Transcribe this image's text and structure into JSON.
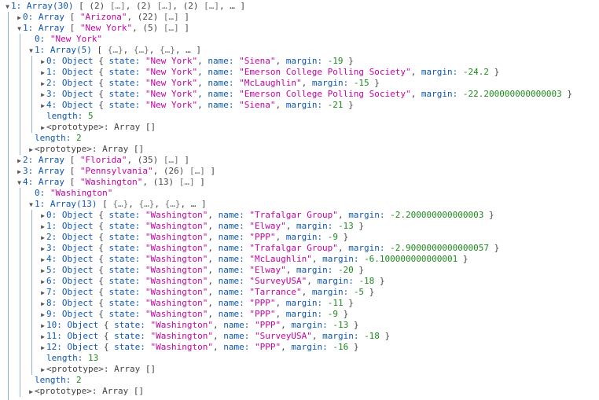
{
  "rows": [
    {
      "d": 0,
      "exp": "open",
      "parts": [
        [
          "k",
          "1: "
        ],
        [
          "t",
          "Array(30)"
        ],
        [
          "p",
          " [ (2) "
        ],
        [
          "m",
          "[…]"
        ],
        [
          "p",
          ", (2) "
        ],
        [
          "m",
          "[…]"
        ],
        [
          "p",
          ", (2) "
        ],
        [
          "m",
          "[…]"
        ],
        [
          "p",
          ", … ]"
        ]
      ]
    },
    {
      "d": 1,
      "exp": "closed",
      "parts": [
        [
          "k",
          "0: "
        ],
        [
          "t",
          "Array"
        ],
        [
          "p",
          " [ "
        ],
        [
          "s",
          "\"Arizona\""
        ],
        [
          "p",
          ", (22) "
        ],
        [
          "m",
          "[…]"
        ],
        [
          "p",
          " ]"
        ]
      ]
    },
    {
      "d": 1,
      "exp": "open",
      "parts": [
        [
          "k",
          "1: "
        ],
        [
          "t",
          "Array"
        ],
        [
          "p",
          " [ "
        ],
        [
          "s",
          "\"New York\""
        ],
        [
          "p",
          ", (5) "
        ],
        [
          "m",
          "[…]"
        ],
        [
          "p",
          " ]"
        ]
      ]
    },
    {
      "d": 2,
      "exp": "none",
      "parts": [
        [
          "k",
          "0: "
        ],
        [
          "s",
          "\"New York\""
        ]
      ]
    },
    {
      "d": 2,
      "exp": "open",
      "parts": [
        [
          "k",
          "1: "
        ],
        [
          "t",
          "Array(5)"
        ],
        [
          "p",
          " [ "
        ],
        [
          "m",
          "{…}"
        ],
        [
          "p",
          ", "
        ],
        [
          "m",
          "{…}"
        ],
        [
          "p",
          ", "
        ],
        [
          "m",
          "{…}"
        ],
        [
          "p",
          ", … ]"
        ]
      ]
    },
    {
      "d": 3,
      "exp": "closed",
      "parts": [
        [
          "k",
          "0: "
        ],
        [
          "t",
          "Object"
        ],
        [
          "p",
          " { "
        ],
        [
          "k",
          "state: "
        ],
        [
          "s",
          "\"New York\""
        ],
        [
          "p",
          ", "
        ],
        [
          "k",
          "name: "
        ],
        [
          "s",
          "\"Siena\""
        ],
        [
          "p",
          ", "
        ],
        [
          "k",
          "margin: "
        ],
        [
          "n",
          "-19"
        ],
        [
          "p",
          " }"
        ]
      ]
    },
    {
      "d": 3,
      "exp": "closed",
      "parts": [
        [
          "k",
          "1: "
        ],
        [
          "t",
          "Object"
        ],
        [
          "p",
          " { "
        ],
        [
          "k",
          "state: "
        ],
        [
          "s",
          "\"New York\""
        ],
        [
          "p",
          ", "
        ],
        [
          "k",
          "name: "
        ],
        [
          "s",
          "\"Emerson College Polling Society\""
        ],
        [
          "p",
          ", "
        ],
        [
          "k",
          "margin: "
        ],
        [
          "n",
          "-24.2"
        ],
        [
          "p",
          " }"
        ]
      ]
    },
    {
      "d": 3,
      "exp": "closed",
      "parts": [
        [
          "k",
          "2: "
        ],
        [
          "t",
          "Object"
        ],
        [
          "p",
          " { "
        ],
        [
          "k",
          "state: "
        ],
        [
          "s",
          "\"New York\""
        ],
        [
          "p",
          ", "
        ],
        [
          "k",
          "name: "
        ],
        [
          "s",
          "\"McLaughlin\""
        ],
        [
          "p",
          ", "
        ],
        [
          "k",
          "margin: "
        ],
        [
          "n",
          "-15"
        ],
        [
          "p",
          " }"
        ]
      ]
    },
    {
      "d": 3,
      "exp": "closed",
      "parts": [
        [
          "k",
          "3: "
        ],
        [
          "t",
          "Object"
        ],
        [
          "p",
          " { "
        ],
        [
          "k",
          "state: "
        ],
        [
          "s",
          "\"New York\""
        ],
        [
          "p",
          ", "
        ],
        [
          "k",
          "name: "
        ],
        [
          "s",
          "\"Emerson College Polling Society\""
        ],
        [
          "p",
          ", "
        ],
        [
          "k",
          "margin: "
        ],
        [
          "n",
          "-22.200000000000003"
        ],
        [
          "p",
          " }"
        ]
      ]
    },
    {
      "d": 3,
      "exp": "closed",
      "parts": [
        [
          "k",
          "4: "
        ],
        [
          "t",
          "Object"
        ],
        [
          "p",
          " { "
        ],
        [
          "k",
          "state: "
        ],
        [
          "s",
          "\"New York\""
        ],
        [
          "p",
          ", "
        ],
        [
          "k",
          "name: "
        ],
        [
          "s",
          "\"Siena\""
        ],
        [
          "p",
          ", "
        ],
        [
          "k",
          "margin: "
        ],
        [
          "n",
          "-21"
        ],
        [
          "p",
          " }"
        ]
      ]
    },
    {
      "d": 3,
      "exp": "none",
      "parts": [
        [
          "k",
          "length: "
        ],
        [
          "n",
          "5"
        ]
      ]
    },
    {
      "d": 3,
      "exp": "closed",
      "parts": [
        [
          "p",
          "<prototype>: Array []"
        ]
      ]
    },
    {
      "d": 2,
      "exp": "none",
      "parts": [
        [
          "k",
          "length: "
        ],
        [
          "n",
          "2"
        ]
      ]
    },
    {
      "d": 2,
      "exp": "closed",
      "parts": [
        [
          "p",
          "<prototype>: Array []"
        ]
      ]
    },
    {
      "d": 1,
      "exp": "closed",
      "parts": [
        [
          "k",
          "2: "
        ],
        [
          "t",
          "Array"
        ],
        [
          "p",
          " [ "
        ],
        [
          "s",
          "\"Florida\""
        ],
        [
          "p",
          ", (35) "
        ],
        [
          "m",
          "[…]"
        ],
        [
          "p",
          " ]"
        ]
      ]
    },
    {
      "d": 1,
      "exp": "closed",
      "parts": [
        [
          "k",
          "3: "
        ],
        [
          "t",
          "Array"
        ],
        [
          "p",
          " [ "
        ],
        [
          "s",
          "\"Pennsylvania\""
        ],
        [
          "p",
          ", (26) "
        ],
        [
          "m",
          "[…]"
        ],
        [
          "p",
          " ]"
        ]
      ]
    },
    {
      "d": 1,
      "exp": "open",
      "parts": [
        [
          "k",
          "4: "
        ],
        [
          "t",
          "Array"
        ],
        [
          "p",
          " [ "
        ],
        [
          "s",
          "\"Washington\""
        ],
        [
          "p",
          ", (13) "
        ],
        [
          "m",
          "[…]"
        ],
        [
          "p",
          " ]"
        ]
      ]
    },
    {
      "d": 2,
      "exp": "none",
      "parts": [
        [
          "k",
          "0: "
        ],
        [
          "s",
          "\"Washington\""
        ]
      ]
    },
    {
      "d": 2,
      "exp": "open",
      "parts": [
        [
          "k",
          "1: "
        ],
        [
          "t",
          "Array(13)"
        ],
        [
          "p",
          " [ "
        ],
        [
          "m",
          "{…}"
        ],
        [
          "p",
          ", "
        ],
        [
          "m",
          "{…}"
        ],
        [
          "p",
          ", "
        ],
        [
          "m",
          "{…}"
        ],
        [
          "p",
          ", … ]"
        ]
      ]
    },
    {
      "d": 3,
      "exp": "closed",
      "parts": [
        [
          "k",
          "0: "
        ],
        [
          "t",
          "Object"
        ],
        [
          "p",
          " { "
        ],
        [
          "k",
          "state: "
        ],
        [
          "s",
          "\"Washington\""
        ],
        [
          "p",
          ", "
        ],
        [
          "k",
          "name: "
        ],
        [
          "s",
          "\"Trafalgar Group\""
        ],
        [
          "p",
          ", "
        ],
        [
          "k",
          "margin: "
        ],
        [
          "n",
          "-2.200000000000003"
        ],
        [
          "p",
          " }"
        ]
      ]
    },
    {
      "d": 3,
      "exp": "closed",
      "parts": [
        [
          "k",
          "1: "
        ],
        [
          "t",
          "Object"
        ],
        [
          "p",
          " { "
        ],
        [
          "k",
          "state: "
        ],
        [
          "s",
          "\"Washington\""
        ],
        [
          "p",
          ", "
        ],
        [
          "k",
          "name: "
        ],
        [
          "s",
          "\"Elway\""
        ],
        [
          "p",
          ", "
        ],
        [
          "k",
          "margin: "
        ],
        [
          "n",
          "-13"
        ],
        [
          "p",
          " }"
        ]
      ]
    },
    {
      "d": 3,
      "exp": "closed",
      "parts": [
        [
          "k",
          "2: "
        ],
        [
          "t",
          "Object"
        ],
        [
          "p",
          " { "
        ],
        [
          "k",
          "state: "
        ],
        [
          "s",
          "\"Washington\""
        ],
        [
          "p",
          ", "
        ],
        [
          "k",
          "name: "
        ],
        [
          "s",
          "\"PPP\""
        ],
        [
          "p",
          ", "
        ],
        [
          "k",
          "margin: "
        ],
        [
          "n",
          "-9"
        ],
        [
          "p",
          " }"
        ]
      ]
    },
    {
      "d": 3,
      "exp": "closed",
      "parts": [
        [
          "k",
          "3: "
        ],
        [
          "t",
          "Object"
        ],
        [
          "p",
          " { "
        ],
        [
          "k",
          "state: "
        ],
        [
          "s",
          "\"Washington\""
        ],
        [
          "p",
          ", "
        ],
        [
          "k",
          "name: "
        ],
        [
          "s",
          "\"Trafalgar Group\""
        ],
        [
          "p",
          ", "
        ],
        [
          "k",
          "margin: "
        ],
        [
          "n",
          "-2.9000000000000057"
        ],
        [
          "p",
          " }"
        ]
      ]
    },
    {
      "d": 3,
      "exp": "closed",
      "parts": [
        [
          "k",
          "4: "
        ],
        [
          "t",
          "Object"
        ],
        [
          "p",
          " { "
        ],
        [
          "k",
          "state: "
        ],
        [
          "s",
          "\"Washington\""
        ],
        [
          "p",
          ", "
        ],
        [
          "k",
          "name: "
        ],
        [
          "s",
          "\"McLaughlin\""
        ],
        [
          "p",
          ", "
        ],
        [
          "k",
          "margin: "
        ],
        [
          "n",
          "-6.100000000000001"
        ],
        [
          "p",
          " }"
        ]
      ]
    },
    {
      "d": 3,
      "exp": "closed",
      "parts": [
        [
          "k",
          "5: "
        ],
        [
          "t",
          "Object"
        ],
        [
          "p",
          " { "
        ],
        [
          "k",
          "state: "
        ],
        [
          "s",
          "\"Washington\""
        ],
        [
          "p",
          ", "
        ],
        [
          "k",
          "name: "
        ],
        [
          "s",
          "\"Elway\""
        ],
        [
          "p",
          ", "
        ],
        [
          "k",
          "margin: "
        ],
        [
          "n",
          "-20"
        ],
        [
          "p",
          " }"
        ]
      ]
    },
    {
      "d": 3,
      "exp": "closed",
      "parts": [
        [
          "k",
          "6: "
        ],
        [
          "t",
          "Object"
        ],
        [
          "p",
          " { "
        ],
        [
          "k",
          "state: "
        ],
        [
          "s",
          "\"Washington\""
        ],
        [
          "p",
          ", "
        ],
        [
          "k",
          "name: "
        ],
        [
          "s",
          "\"SurveyUSA\""
        ],
        [
          "p",
          ", "
        ],
        [
          "k",
          "margin: "
        ],
        [
          "n",
          "-18"
        ],
        [
          "p",
          " }"
        ]
      ]
    },
    {
      "d": 3,
      "exp": "closed",
      "parts": [
        [
          "k",
          "7: "
        ],
        [
          "t",
          "Object"
        ],
        [
          "p",
          " { "
        ],
        [
          "k",
          "state: "
        ],
        [
          "s",
          "\"Washington\""
        ],
        [
          "p",
          ", "
        ],
        [
          "k",
          "name: "
        ],
        [
          "s",
          "\"Tarrance\""
        ],
        [
          "p",
          ", "
        ],
        [
          "k",
          "margin: "
        ],
        [
          "n",
          "-5"
        ],
        [
          "p",
          " }"
        ]
      ]
    },
    {
      "d": 3,
      "exp": "closed",
      "parts": [
        [
          "k",
          "8: "
        ],
        [
          "t",
          "Object"
        ],
        [
          "p",
          " { "
        ],
        [
          "k",
          "state: "
        ],
        [
          "s",
          "\"Washington\""
        ],
        [
          "p",
          ", "
        ],
        [
          "k",
          "name: "
        ],
        [
          "s",
          "\"PPP\""
        ],
        [
          "p",
          ", "
        ],
        [
          "k",
          "margin: "
        ],
        [
          "n",
          "-11"
        ],
        [
          "p",
          " }"
        ]
      ]
    },
    {
      "d": 3,
      "exp": "closed",
      "parts": [
        [
          "k",
          "9: "
        ],
        [
          "t",
          "Object"
        ],
        [
          "p",
          " { "
        ],
        [
          "k",
          "state: "
        ],
        [
          "s",
          "\"Washington\""
        ],
        [
          "p",
          ", "
        ],
        [
          "k",
          "name: "
        ],
        [
          "s",
          "\"PPP\""
        ],
        [
          "p",
          ", "
        ],
        [
          "k",
          "margin: "
        ],
        [
          "n",
          "-9"
        ],
        [
          "p",
          " }"
        ]
      ]
    },
    {
      "d": 3,
      "exp": "closed",
      "parts": [
        [
          "k",
          "10: "
        ],
        [
          "t",
          "Object"
        ],
        [
          "p",
          " { "
        ],
        [
          "k",
          "state: "
        ],
        [
          "s",
          "\"Washington\""
        ],
        [
          "p",
          ", "
        ],
        [
          "k",
          "name: "
        ],
        [
          "s",
          "\"PPP\""
        ],
        [
          "p",
          ", "
        ],
        [
          "k",
          "margin: "
        ],
        [
          "n",
          "-13"
        ],
        [
          "p",
          " }"
        ]
      ]
    },
    {
      "d": 3,
      "exp": "closed",
      "parts": [
        [
          "k",
          "11: "
        ],
        [
          "t",
          "Object"
        ],
        [
          "p",
          " { "
        ],
        [
          "k",
          "state: "
        ],
        [
          "s",
          "\"Washington\""
        ],
        [
          "p",
          ", "
        ],
        [
          "k",
          "name: "
        ],
        [
          "s",
          "\"SurveyUSA\""
        ],
        [
          "p",
          ", "
        ],
        [
          "k",
          "margin: "
        ],
        [
          "n",
          "-18"
        ],
        [
          "p",
          " }"
        ]
      ]
    },
    {
      "d": 3,
      "exp": "closed",
      "parts": [
        [
          "k",
          "12: "
        ],
        [
          "t",
          "Object"
        ],
        [
          "p",
          " { "
        ],
        [
          "k",
          "state: "
        ],
        [
          "s",
          "\"Washington\""
        ],
        [
          "p",
          ", "
        ],
        [
          "k",
          "name: "
        ],
        [
          "s",
          "\"PPP\""
        ],
        [
          "p",
          ", "
        ],
        [
          "k",
          "margin: "
        ],
        [
          "n",
          "-16"
        ],
        [
          "p",
          " }"
        ]
      ]
    },
    {
      "d": 3,
      "exp": "none",
      "parts": [
        [
          "k",
          "length: "
        ],
        [
          "n",
          "13"
        ]
      ]
    },
    {
      "d": 3,
      "exp": "closed",
      "parts": [
        [
          "p",
          "<prototype>: Array []"
        ]
      ]
    },
    {
      "d": 2,
      "exp": "none",
      "parts": [
        [
          "k",
          "length: "
        ],
        [
          "n",
          "2"
        ]
      ]
    },
    {
      "d": 2,
      "exp": "closed",
      "parts": [
        [
          "p",
          "<prototype>: Array []"
        ]
      ]
    }
  ],
  "icons": {
    "open": "▼",
    "closed": "▶"
  }
}
